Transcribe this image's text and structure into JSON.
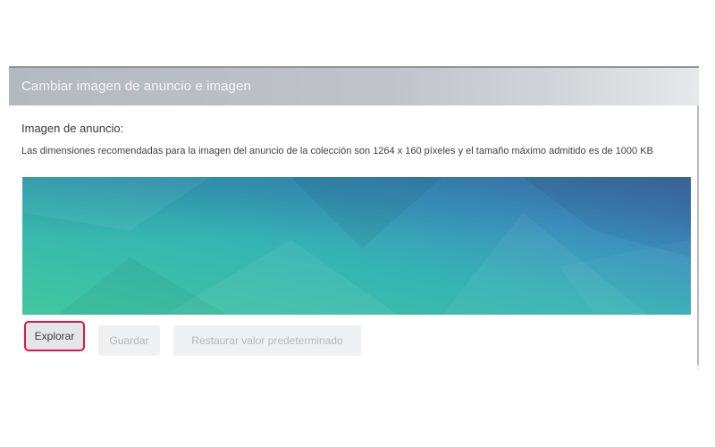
{
  "dialog": {
    "title": "Cambiar imagen de anuncio e imagen",
    "field_label": "Imagen de anuncio:",
    "description": "Las dimensiones recomendadas para la imagen del anuncio de la colección son 1264 x 160 píxeles y el tamaño máximo admitido es de 1000 KB",
    "buttons": {
      "explore": "Explorar",
      "save": "Guardar",
      "restore": "Restaurar valor predeterminado"
    }
  },
  "colors": {
    "highlight": "#e0134a",
    "banner_start": "#3fbfa5",
    "banner_end": "#4a6fb3"
  }
}
